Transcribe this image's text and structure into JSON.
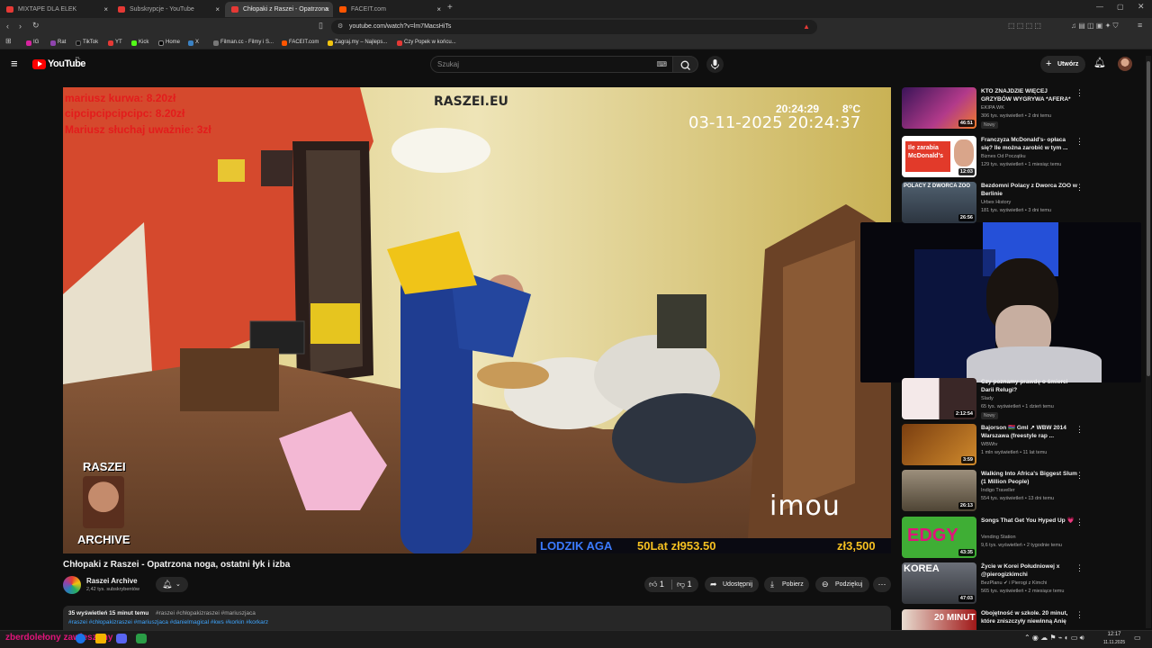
{
  "browser": {
    "tabs": [
      {
        "label": "MIXTAPE DLA ELEK"
      },
      {
        "label": "Subskrypcje - YouTube"
      },
      {
        "label": "Chłopaki z Raszei - Opatrzona"
      },
      {
        "label": "FACEIT.com"
      }
    ],
    "url": "youtube.com/watch?v=lm7MacsHiTs",
    "bookmarks": [
      "IG",
      "Rat",
      "TikTok",
      "YT",
      "Kick",
      "Home",
      "X",
      "Filman.cc - Filmy i S...",
      "FACEIT.com",
      "Zagraj.my – Najleps...",
      "Czy Popek w końcu..."
    ]
  },
  "youtube": {
    "logo": "YouTube",
    "region": "PL",
    "search_placeholder": "Szukaj",
    "create_label": "Utwórz"
  },
  "video": {
    "overlay_lines": [
      "mariusz kurwa: 8.20zł",
      "cipcipcipcipcipc: 8.20zł",
      "Mariusz słuchaj uważnie: 3zł"
    ],
    "watermark": "RASZEI.EU",
    "clock": "20:24:29",
    "temperature": "8°C",
    "timestamp": "03-11-2025 20:24:37",
    "channel_tag_top": "RASZEI",
    "channel_tag_bottom": "ARCHIVE",
    "ticker_name": "LODZIK AGA",
    "ticker_text": "50Lat zł953.50",
    "ticker_goal": "zł3,500",
    "brand": "imou"
  },
  "meta": {
    "title": "Chłopaki z Raszei - Opatrzona noga, ostatni łyk i izba",
    "channel": "Raszei Archive",
    "subscribers": "2,42 tys. subskrybentów",
    "likes": "1",
    "dislikes": "1",
    "share": "Udostępnij",
    "download": "Pobierz",
    "thanks": "Podziękuj",
    "desc_views": "35 wyświetleń  15 minut temu",
    "desc_tags1": "#raszei #chłopakizraszei #mariuszjaca",
    "desc_tags2": "#raszei #chłopakizraszei #mariuszjaca #danielmagical #kws #korkin #korkarz"
  },
  "recommendations": [
    {
      "title": "KTO ZNAJDZIE WIĘCEJ GRZYBÓW WYGRYWA *AFERA*",
      "channel": "EKIPA WK",
      "meta": "306 tys. wyświetleń • 2 dni temu",
      "badge": "Nowy",
      "duration": "46:51",
      "thumb_color": "#6a2c8c"
    },
    {
      "title": "Franczyza McDonald's- opłaca się? Ile można zarobić w tym ...",
      "channel": "Biznes Od Początku",
      "meta": "129 tys. wyświetleń • 1 miesiąc temu",
      "badge": "",
      "duration": "12:03",
      "thumb_color": "#c0392b",
      "thumb_text": "Ile zarabia McDonald's"
    },
    {
      "title": "Bezdomni Polacy z Dworca ZOO w Berlinie",
      "channel": "Urbex History",
      "meta": "181 tys. wyświetleń • 3 dni temu",
      "badge": "",
      "duration": "26:56",
      "thumb_color": "#3e4a58",
      "thumb_text": "POLACY Z DWORCA ZOO"
    },
    {
      "title": "Czy poznamy prawdę o śmierci Darii Relugi?",
      "channel": "Slady",
      "meta": "65 tys. wyświetleń • 1 dzień temu",
      "badge": "Nowy",
      "duration": "2:12:54",
      "thumb_color": "#5a1f1f"
    },
    {
      "title": "Bajorson 🇬🇲 Gml ↗ WBW 2014 Warszawa (freestyle rap ...",
      "channel": "WBWtv",
      "meta": "1 mln wyświetleń • 11 lat temu",
      "badge": "",
      "duration": "3:59",
      "thumb_color": "#8a5a14"
    },
    {
      "title": "Walking Into Africa's Biggest Slum (1 Million People)",
      "channel": "Indigo Traveller",
      "meta": "554 tys. wyświetleń • 13 dni temu",
      "badge": "",
      "duration": "26:13",
      "thumb_color": "#6b5d4a"
    },
    {
      "title": "Songs That Get You Hyped Up 💗",
      "channel": "Vending Station",
      "meta": "9,6 tys. wyświetleń • 2 tygodnie temu",
      "badge": "",
      "duration": "43:35",
      "thumb_color": "#3fae35",
      "thumb_text": "EDGY"
    },
    {
      "title": "Życie w Korei Południowej x @pierogizkimchi",
      "channel": "BezPlanu ✔ i Pierogi z Kimchi",
      "meta": "565 tys. wyświetleń • 2 miesiące temu",
      "badge": "",
      "duration": "47:03",
      "thumb_color": "#4a4e57",
      "thumb_text": "KOREA"
    },
    {
      "title": "Obojętność w szkole. 20 minut, które zniszczyły niewinną Anię",
      "channel": "",
      "meta": "",
      "badge": "",
      "duration": "",
      "thumb_color": "#7a1c1c",
      "thumb_text": "20 MINUT"
    }
  ],
  "taskbar": {
    "marquee": "zberdolełony zawieszony",
    "time": "12:17",
    "date": "11.11.2025"
  }
}
